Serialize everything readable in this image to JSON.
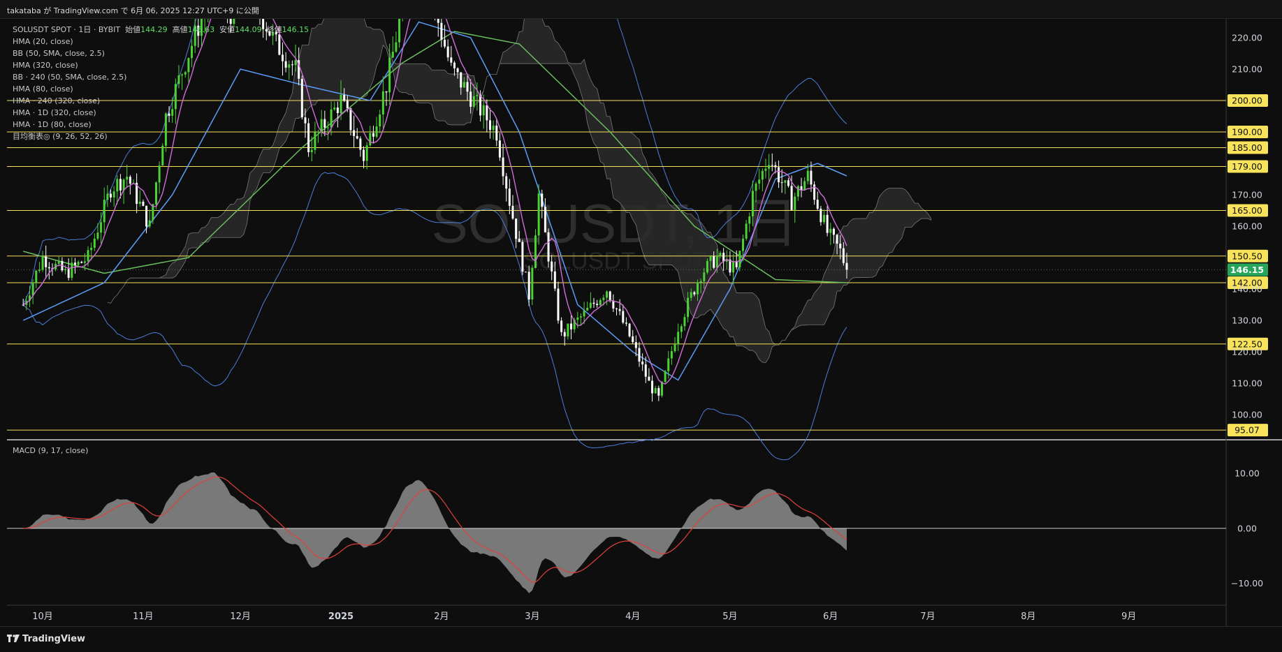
{
  "header": {
    "user": "takataba",
    "published_text": "takataba が TradingView.com で 6月 06, 2025 12:27 UTC+9 に公開"
  },
  "legend": {
    "symbol_line": "SOLUSDT SPOT · 1日 · BYBIT",
    "open_label": "始値",
    "open": "144.29",
    "high_label": "高値",
    "high": "146.63",
    "low_label": "安値",
    "low": "144.09",
    "close_label": "終値",
    "close": "146.15",
    "indicators": [
      "HMA (20, close)",
      "BB (50, SMA, close, 2.5)",
      "HMA (320, close)",
      "BB · 240 (50, SMA, close, 2.5)",
      "HMA (80, close)",
      "HMA · 240 (320, close)",
      "HMA · 1D (320, close)",
      "HMA · 1D (80, close)",
      "目均衡表◎ (9, 26, 52, 26)"
    ]
  },
  "watermark": {
    "main": "SOLUSDT, 1日",
    "sub": "SOLUSDT SPOT"
  },
  "macd_legend": "MACD (9, 17, close)",
  "footer": {
    "brand": "TradingView"
  },
  "colors": {
    "up": "#4cd137",
    "down": "#ffffff",
    "hma20": "#d06fd6",
    "hma80": "#5a9cf8",
    "hma320": "#6abf5e",
    "bb": "#4a7fd9",
    "level": "#f5e05a",
    "level_bg": "#f8e35a",
    "price_tag": "#26a65b",
    "macd_hist": "#8c8c8c",
    "macd_signal": "#e0413b"
  },
  "chart_data": {
    "type": "candlestick",
    "title": "SOLUSDT, 1日",
    "y_axis": {
      "range": [
        92,
        226
      ],
      "ticks": [
        "220.00",
        "210.00",
        "200.00",
        "190.00",
        "185.00",
        "179.00",
        "170.00",
        "165.00",
        "160.00",
        "150.50",
        "146.15",
        "142.00",
        "140.00",
        "130.00",
        "122.50",
        "120.00",
        "110.00",
        "100.00",
        "95.07"
      ]
    },
    "x_axis_labels": [
      "10月",
      "11月",
      "12月",
      "2025",
      "2月",
      "3月",
      "4月",
      "5月",
      "6月",
      "7月",
      "8月",
      "9月"
    ],
    "horizontal_levels": [
      200.0,
      190.0,
      185.0,
      179.0,
      165.0,
      150.5,
      142.0,
      122.5,
      95.07
    ],
    "last_price": 146.15,
    "price_anchors": [
      [
        "2024-09-25",
        135
      ],
      [
        "2024-10-01",
        150
      ],
      [
        "2024-10-08",
        145
      ],
      [
        "2024-10-15",
        150
      ],
      [
        "2024-10-22",
        172
      ],
      [
        "2024-10-27",
        176
      ],
      [
        "2024-11-03",
        160
      ],
      [
        "2024-11-08",
        195
      ],
      [
        "2024-11-15",
        215
      ],
      [
        "2024-11-22",
        235
      ],
      [
        "2024-11-28",
        228
      ],
      [
        "2024-12-05",
        232
      ],
      [
        "2024-12-12",
        218
      ],
      [
        "2024-12-18",
        210
      ],
      [
        "2024-12-22",
        185
      ],
      [
        "2025-01-01",
        200
      ],
      [
        "2025-01-08",
        182
      ],
      [
        "2025-01-15",
        205
      ],
      [
        "2025-01-20",
        230
      ],
      [
        "2025-01-25",
        245
      ],
      [
        "2025-01-31",
        225
      ],
      [
        "2025-02-04",
        210
      ],
      [
        "2025-02-11",
        200
      ],
      [
        "2025-02-18",
        190
      ],
      [
        "2025-02-22",
        168
      ],
      [
        "2025-02-28",
        138
      ],
      [
        "2025-03-03",
        170
      ],
      [
        "2025-03-10",
        125
      ],
      [
        "2025-03-17",
        132
      ],
      [
        "2025-03-24",
        140
      ],
      [
        "2025-03-31",
        125
      ],
      [
        "2025-04-06",
        110
      ],
      [
        "2025-04-09",
        105
      ],
      [
        "2025-04-15",
        128
      ],
      [
        "2025-04-22",
        145
      ],
      [
        "2025-04-27",
        150
      ],
      [
        "2025-05-03",
        146
      ],
      [
        "2025-05-08",
        170
      ],
      [
        "2025-05-13",
        182
      ],
      [
        "2025-05-20",
        168
      ],
      [
        "2025-05-25",
        176
      ],
      [
        "2025-05-31",
        158
      ],
      [
        "2025-06-04",
        152
      ],
      [
        "2025-06-06",
        146.15
      ]
    ],
    "hma80_anchors": [
      [
        "2024-09-25",
        130
      ],
      [
        "2024-10-20",
        142
      ],
      [
        "2024-11-10",
        170
      ],
      [
        "2024-12-01",
        210
      ],
      [
        "2024-12-20",
        205
      ],
      [
        "2025-01-10",
        200
      ],
      [
        "2025-01-25",
        225
      ],
      [
        "2025-02-10",
        220
      ],
      [
        "2025-02-25",
        190
      ],
      [
        "2025-03-15",
        135
      ],
      [
        "2025-04-01",
        120
      ],
      [
        "2025-04-15",
        111
      ],
      [
        "2025-05-01",
        140
      ],
      [
        "2025-05-15",
        175
      ],
      [
        "2025-05-28",
        180
      ],
      [
        "2025-06-06",
        176
      ]
    ],
    "hma320_anchors": [
      [
        "2024-09-25",
        152
      ],
      [
        "2024-10-20",
        145
      ],
      [
        "2024-11-15",
        150
      ],
      [
        "2024-12-20",
        185
      ],
      [
        "2025-01-20",
        212
      ],
      [
        "2025-02-05",
        222
      ],
      [
        "2025-02-25",
        218
      ],
      [
        "2025-03-25",
        190
      ],
      [
        "2025-04-20",
        160
      ],
      [
        "2025-05-15",
        143
      ],
      [
        "2025-06-06",
        142
      ]
    ],
    "macd": {
      "range": [
        -14,
        16
      ],
      "zero_label": "0.00",
      "ticks": [
        "10.00",
        "0.00",
        "−10.00"
      ]
    }
  }
}
